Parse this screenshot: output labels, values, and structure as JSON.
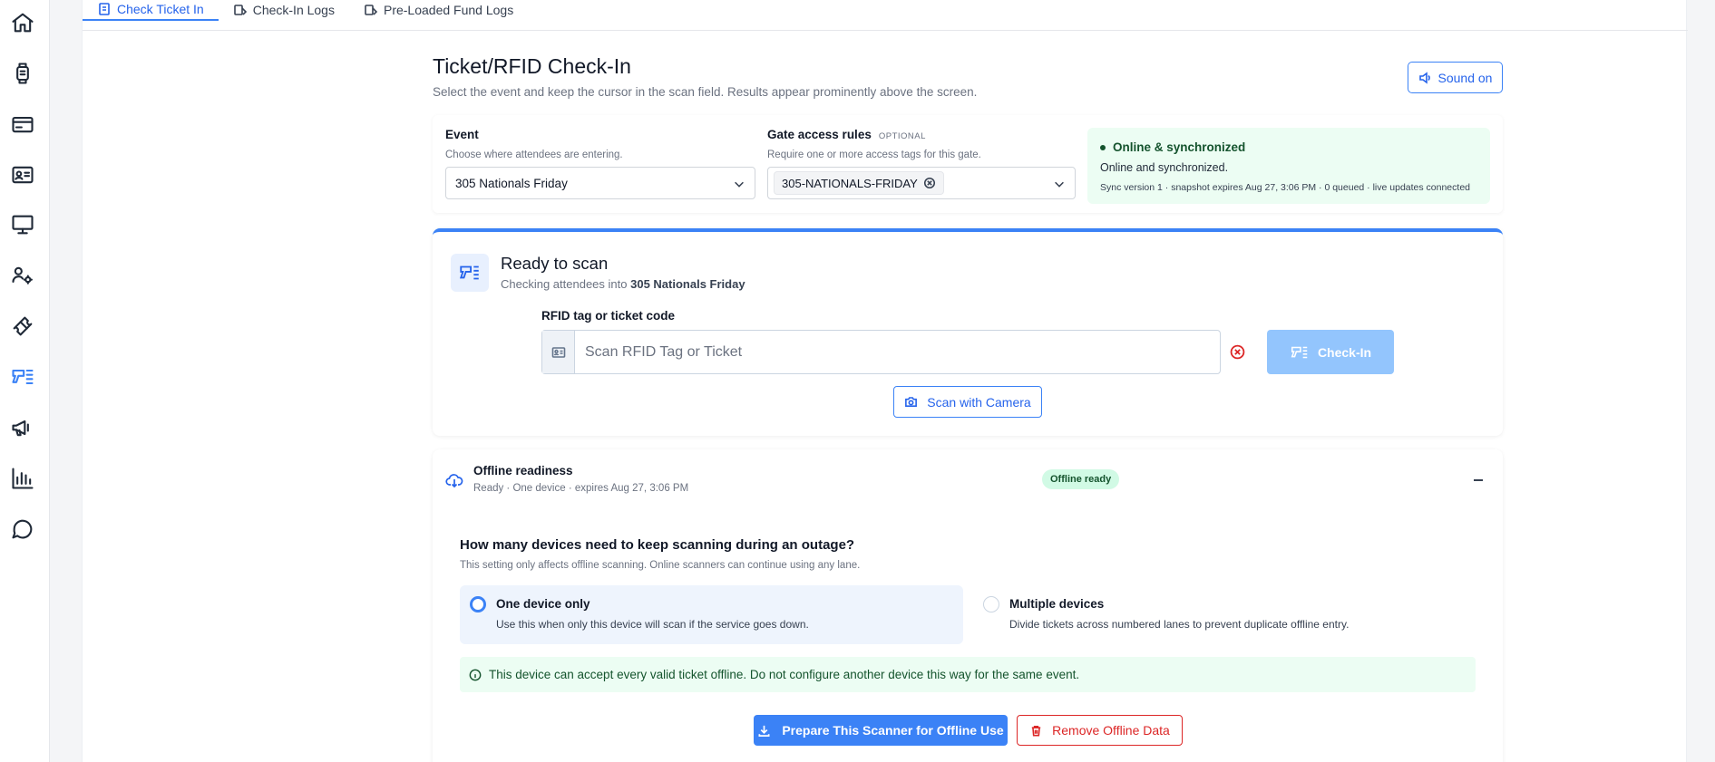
{
  "sidebar": {
    "items": [
      {
        "icon": "home-icon",
        "name": "sidebar-item-home"
      },
      {
        "icon": "watch-icon",
        "name": "sidebar-item-wristbands"
      },
      {
        "icon": "credit-card-icon",
        "name": "sidebar-item-payments"
      },
      {
        "icon": "id-card-icon",
        "name": "sidebar-item-attendees"
      },
      {
        "icon": "monitor-icon",
        "name": "sidebar-item-pos"
      },
      {
        "icon": "users-gear-icon",
        "name": "sidebar-item-staff"
      },
      {
        "icon": "ticket-icon",
        "name": "sidebar-item-tickets"
      },
      {
        "icon": "scanner-icon",
        "name": "sidebar-item-check-in"
      },
      {
        "icon": "megaphone-icon",
        "name": "sidebar-item-marketing"
      },
      {
        "icon": "bar-chart-icon",
        "name": "sidebar-item-reports"
      },
      {
        "icon": "chat-icon",
        "name": "sidebar-item-messages"
      }
    ],
    "active_index": 7
  },
  "tabs": [
    {
      "label": "Check Ticket In",
      "active": true
    },
    {
      "label": "Check-In Logs",
      "active": false
    },
    {
      "label": "Pre-Loaded Fund Logs",
      "active": false
    }
  ],
  "page": {
    "title": "Ticket/RFID Check-In",
    "subtitle": "Select the event and keep the cursor in the scan field. Results appear prominently above the screen.",
    "sound_button": "Sound on"
  },
  "filters": {
    "event_label": "Event",
    "event_help": "Choose where attendees are entering.",
    "event_value": "305 Nationals Friday",
    "gate_label": "Gate access rules",
    "gate_optional": "OPTIONAL",
    "gate_help": "Require one or more access tags for this gate.",
    "gate_chip": "305-NATIONALS-FRIDAY"
  },
  "status": {
    "title": "Online & synchronized",
    "line1": "Online and synchronized.",
    "line2": "Sync version 1 · snapshot expires Aug 27, 3:06 PM · 0 queued · live updates connected"
  },
  "scan": {
    "title": "Ready to scan",
    "sub_prefix": "Checking attendees into ",
    "sub_event": "305 Nationals Friday",
    "field_label": "RFID tag or ticket code",
    "placeholder": "Scan RFID Tag or Ticket",
    "checkin_button": "Check-In",
    "camera_button": "Scan with Camera"
  },
  "offline": {
    "title": "Offline readiness",
    "subtitle": "Ready · One device · expires Aug 27, 3:06 PM",
    "badge": "Offline ready",
    "question": "How many devices need to keep scanning during an outage?",
    "question_sub": "This setting only affects offline scanning. Online scanners can continue using any lane.",
    "options": [
      {
        "title": "One device only",
        "desc": "Use this when only this device will scan if the service goes down.",
        "selected": true
      },
      {
        "title": "Multiple devices",
        "desc": "Divide tickets across numbered lanes to prevent duplicate offline entry.",
        "selected": false
      }
    ],
    "info": "This device can accept every valid ticket offline. Do not configure another device this way for the same event.",
    "prepare_button": "Prepare This Scanner for Offline Use",
    "remove_button": "Remove Offline Data"
  },
  "colors": {
    "accent": "#3b82f6",
    "success_bg": "#ecfdf3",
    "success_text": "#14532d",
    "danger": "#dc2626"
  }
}
